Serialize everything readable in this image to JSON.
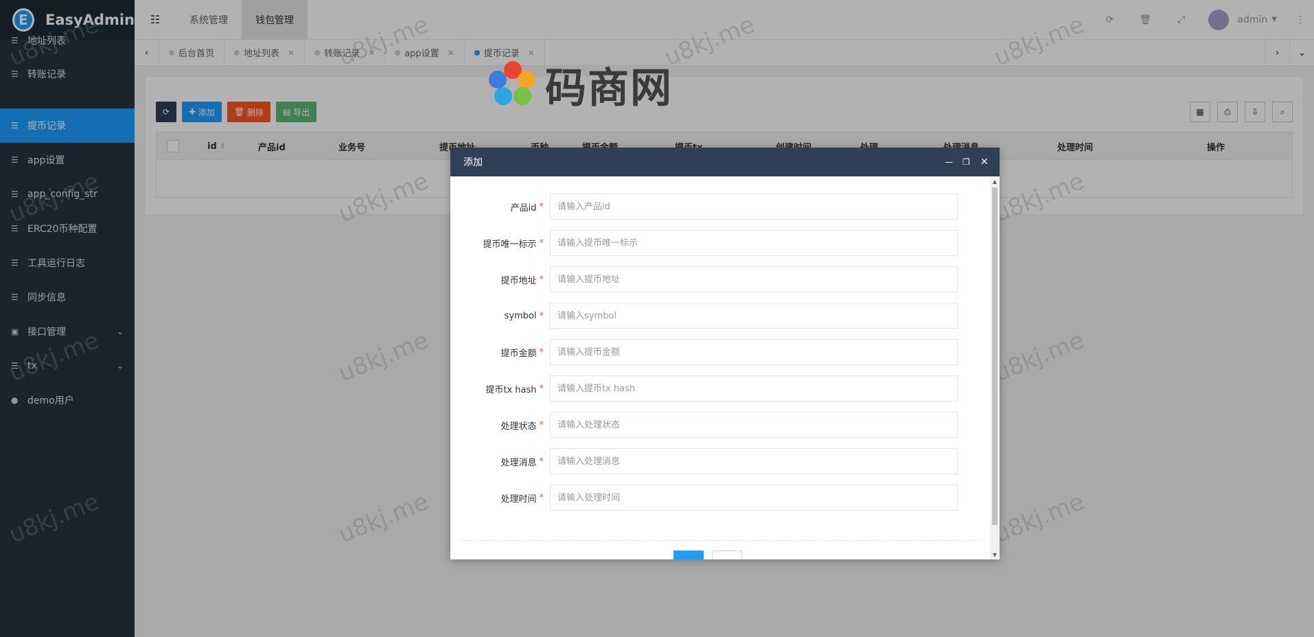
{
  "app": {
    "logo_text": "EasyAdmin"
  },
  "sidebar": {
    "items": [
      {
        "label": "地址列表",
        "icon": "list-icon"
      },
      {
        "label": "转账记录",
        "icon": "list-icon"
      },
      {
        "label": "提币记录",
        "icon": "list-icon",
        "active": true
      },
      {
        "label": "app设置",
        "icon": "list-icon"
      },
      {
        "label": "app_config_str",
        "icon": "list-icon"
      },
      {
        "label": "ERC20币种配置",
        "icon": "list-icon"
      },
      {
        "label": "工具运行日志",
        "icon": "list-icon"
      },
      {
        "label": "同步信息",
        "icon": "list-icon"
      },
      {
        "label": "接口管理",
        "icon": "address-book-icon",
        "has_children": true
      },
      {
        "label": "tx",
        "icon": "list-icon",
        "has_children": true
      },
      {
        "label": "demo用户",
        "icon": "user-icon"
      }
    ]
  },
  "header": {
    "nav": [
      {
        "label": "系统管理"
      },
      {
        "label": "钱包管理",
        "active": true
      }
    ],
    "user": "admin"
  },
  "tabs": [
    {
      "label": "后台首页",
      "closable": false
    },
    {
      "label": "地址列表",
      "closable": true
    },
    {
      "label": "转账记录",
      "closable": true
    },
    {
      "label": "app设置",
      "closable": true
    },
    {
      "label": "提币记录",
      "closable": true,
      "active": true
    }
  ],
  "toolbar": {
    "add": "添加",
    "delete": "删除",
    "export": "导出"
  },
  "table": {
    "columns": [
      "id",
      "产品id",
      "业务号",
      "提币地址",
      "币种",
      "提币金额",
      "提币tx",
      "创建时间",
      "处理",
      "处理消息",
      "处理时间",
      "操作"
    ]
  },
  "modal": {
    "title": "添加",
    "fields": [
      {
        "label": "产品id",
        "placeholder": "请输入产品id"
      },
      {
        "label": "提币唯一标示",
        "placeholder": "请输入提币唯一标示"
      },
      {
        "label": "提币地址",
        "placeholder": "请输入提币地址"
      },
      {
        "label": "symbol",
        "placeholder": "请输入symbol"
      },
      {
        "label": "提币金额",
        "placeholder": "请输入提币金额"
      },
      {
        "label": "提币tx hash",
        "placeholder": "请输入提币tx hash"
      },
      {
        "label": "处理状态",
        "placeholder": "请输入处理状态"
      },
      {
        "label": "处理消息",
        "placeholder": "请输入处理消息"
      },
      {
        "label": "处理时间",
        "placeholder": "请输入处理时间"
      }
    ]
  },
  "watermark": {
    "text": "u8kj.me",
    "brand": "码商网"
  },
  "colors": {
    "sidebar_bg": "#28333e",
    "active": "#1e9fff",
    "modal_title_bg": "#2f4056",
    "required": "#ff5722"
  }
}
